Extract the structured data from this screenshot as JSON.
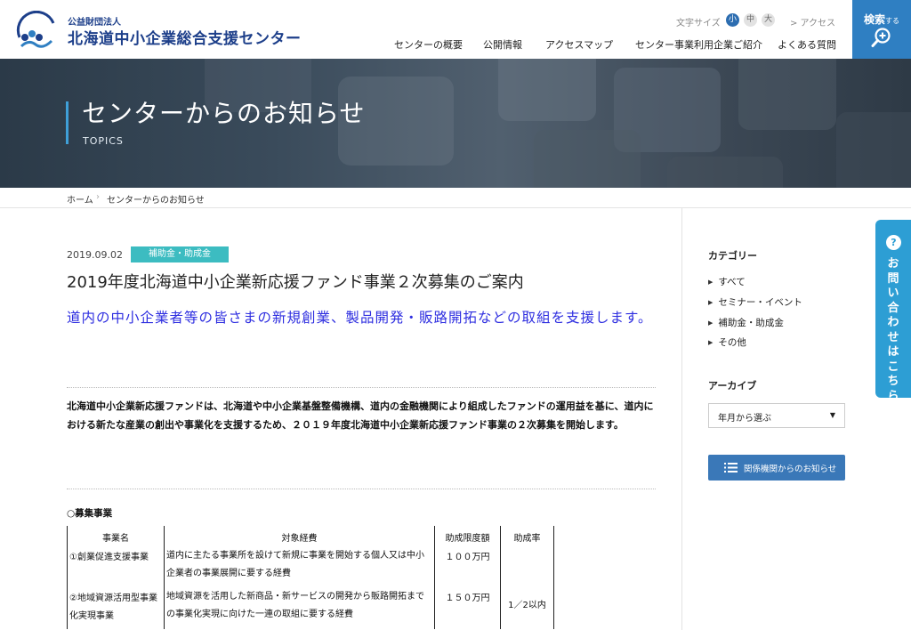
{
  "header": {
    "org_type": "公益財団法人",
    "org_name": "北海道中小企業総合支援センター",
    "font_size_label": "文字サイズ",
    "font_sizes": [
      "小",
      "中",
      "大"
    ],
    "access_link": "> アクセス",
    "nav": [
      "センターの概要",
      "公開情報",
      "アクセスマップ",
      "センター事業利用企業ご紹介",
      "よくある質問"
    ],
    "search_label": "検索",
    "search_suffix": "する"
  },
  "hero": {
    "title": "センターからのお知らせ",
    "subtitle": "TOPICS"
  },
  "breadcrumb": {
    "home": "ホーム",
    "separator": "›",
    "current": "センターからのお知らせ"
  },
  "article": {
    "date": "2019.09.02",
    "category": "補助金・助成金",
    "title": "2019年度北海道中小企業新応援ファンド事業２次募集のご案内",
    "lead": "道内の中小企業者等の皆さまの新規創業、製品開発・販路開拓などの取組を支援します。",
    "body": "北海道中小企業新応援ファンドは、北海道や中小企業基盤整備機構、道内の金融機関により組成したファンドの運用益を基に、道内における新たな産業の創出や事業化を支援するため、２０１９年度北海道中小企業新応援ファンド事業の２次募集を開始します。",
    "section_heading": "○募集事業",
    "table": {
      "headers": [
        "事業名",
        "対象経費",
        "助成限度額",
        "助成率"
      ],
      "rows": [
        {
          "name": "①創業促進支援事業",
          "cost": "道内に主たる事業所を設けて新規に事業を開始する個人又は中小企業者の事業展開に要する経費",
          "limit": "１００万円"
        },
        {
          "name": "②地域資源活用型事業化実現事業",
          "cost": "地域資源を活用した新商品・新サービスの開発から販路開拓までの事業化実現に向けた一連の取組に要する経費",
          "limit": "１５０万円"
        }
      ],
      "rate": "1／2以内"
    }
  },
  "sidebar": {
    "category_heading": "カテゴリー",
    "categories": [
      "すべて",
      "セミナー・イベント",
      "補助金・助成金",
      "その他"
    ],
    "archive_heading": "アーカイブ",
    "archive_select": "年月から選ぶ",
    "related_button": "関係機関からのお知らせ"
  },
  "contact_tab": {
    "icon": "?",
    "label": "お問い合わせはこちら"
  },
  "colors": {
    "brand_blue": "#1d3f8a",
    "accent_blue": "#2f7fc2",
    "badge_teal": "#3cbcc1",
    "lead_blue": "#2e2ee0"
  }
}
